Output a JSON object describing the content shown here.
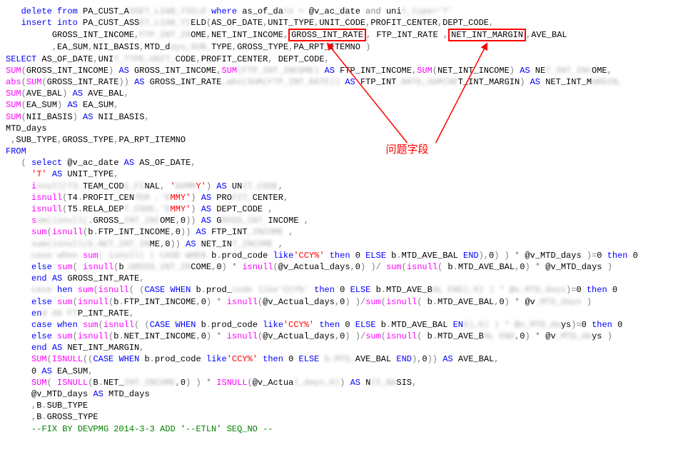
{
  "label": "问题字段",
  "box1_text": "GROSS_INT_RATE",
  "box2_text": "NET_INT_MARGIN",
  "code": {
    "l01": {
      "a": "delete from",
      "b": " PA_CUST_A",
      "blur1": "SSET_LIAB",
      "blur2": "_YIELD ",
      "c": "where",
      "d": " as_of_da",
      "blur3": "te =",
      "e": " @v_ac_date ",
      "f": "and",
      "g": " uni",
      "blur4": "t_type='T'"
    },
    "l02": {
      "a": "insert into",
      "b": " PA_CUST_ASS",
      "blur1": "ET_LIAB_YI",
      "c": "ELD",
      "d": "AS_OF_DATE",
      "e": "UNIT_TYPE",
      "f": "UNIT_CODE",
      "g": "PROFIT_CENTER",
      "h": "DEPT_CODE"
    },
    "l03": {
      "a": "GROSS_INT_INCOME",
      "blur1": "FTP_INT_IN",
      "b": "OME",
      "c": "NET_INT_INCOME",
      "d": " FTP_INT_RATE ",
      "e": "AVE_BAL"
    },
    "l04": {
      "a": "EA_SUM",
      "b": "NII_BASIS",
      "c": "MTD_d",
      "blur1": "ays,S",
      "blur2": "UB_",
      "d": "TYPE",
      "e": "GROSS_TYPE",
      "f": "PA_RPT_ITEMNO"
    },
    "l05": {
      "a": "SELECT",
      "b": " AS_OF_DATE",
      "c": "UNI",
      "blur1": "T_TYPE,UNIT_",
      "d": "CODE",
      "e": "PROFIT_CENTER",
      "f": " DEPT_CODE"
    },
    "l06": {
      "a": "SUM",
      "b": "GROSS_INT_INCOME",
      "c": "AS",
      "d": " GROSS_INT_INCOME",
      "e": "SUM",
      "blur1": "(FTP_INT_INCOME)",
      "f": "AS",
      "g": " FTP_INT_INCOME",
      "h": "SUM",
      "i": "NET_INT_INCOME",
      "j": "AS",
      "k": " NE",
      "blur2": "T_INT_INC",
      "l": "OME"
    },
    "l07": {
      "a": "abs",
      "b": "SUM",
      "c": "GROSS_INT_RATE",
      "d": "AS",
      "e": " GROSS_INT_RATE",
      "blur1": ",abs(SUM(FTP_INT_RATE))",
      "f": "AS",
      "g": " FTP_INT",
      "blur2": "_RATE,SUM(NE",
      "h": "T_INT_MARGIN",
      "i": "AS",
      "j": " NET_INT_M",
      "blur3": "ARGIN,"
    },
    "l08": {
      "a": "SUM",
      "b": "AVE_BAL",
      "c": "AS",
      "d": " AVE_BAL"
    },
    "l09": {
      "a": "SUM",
      "b": "EA_SUM",
      "c": "AS",
      "d": " EA_SUM"
    },
    "l10": {
      "a": "SUM",
      "b": "NII_BASIS",
      "c": "AS",
      "d": " NII_BASIS"
    },
    "l11": {
      "a": "MTD_days"
    },
    "l12": {
      "a": "SUB_TYPE",
      "b": "GROSS_TYPE",
      "c": "PA_RPT_ITEMNO"
    },
    "l13": {
      "a": "FROM"
    },
    "l14": {
      "a": "select",
      "b": " @v_ac_date ",
      "c": "AS",
      "d": " AS_OF_DATE"
    },
    "l15": {
      "a": "'T'",
      "b": "AS",
      "c": " UNIT_TYPE"
    },
    "l16": {
      "a": "i",
      "blur1": "snull(T3.",
      "b": "TEAM_COD",
      "blur2": "E_FI",
      "c": "NAL",
      "d": "'",
      "blur3": "DUMM",
      "e": "Y'",
      "f": "AS",
      "g": " UN",
      "blur4": "IT_CODE"
    },
    "l17": {
      "a": "isnull",
      "b": "T4",
      "c": "PROFIT_CEN",
      "blur1": "TER ,'D",
      "d": "MMY'",
      "e": "AS",
      "f": " PRO",
      "blur2": "FIT_",
      "g": "CENTER"
    },
    "l18": {
      "a": "isnull",
      "b": "T5",
      "c": "RELA_DEP",
      "blur1": "T_CODE,'D",
      "d": "MMY'",
      "e": "AS",
      "f": " DEPT_CODE"
    },
    "l19": {
      "a": "s",
      "blur1": "um(isnull(",
      "b": "GROSS_",
      "blur2": "INT_INC",
      "c": "OME",
      "d": "0",
      "e": "AS",
      "f": " G",
      "blur3": "ROSS_INT_",
      "g": "INCOME"
    },
    "l20": {
      "a": "sum",
      "b": "isnull",
      "c": "b",
      "d": "FTP_INT_INCOME",
      "e": "0",
      "f": "AS",
      "g": " FTP_INT",
      "blur1": "_INCOME"
    },
    "l21": {
      "a": "sum(isnull(b.NET_INT_IN",
      "b": "ME",
      "c": "0",
      "d": "AS",
      "e": " NET_IN",
      "blur1": "T_INCOME"
    },
    "l22": {
      "blur1": "case when",
      "a": "sum",
      "blur2": "( isnull( ( CASE WHEN",
      "b": " b",
      "c": "prod_code ",
      "d": "like",
      "e": "'CCY%'",
      "f": "then",
      "g": " 0 ",
      "h": "ELSE",
      "i": "  b",
      "j": "MTD_AVE_BAL ",
      "k": "END",
      "l": "0",
      "m": " @v_MTD_days",
      "n": "0 ",
      "o": "then",
      "p": " 0"
    },
    "l23": {
      "a": "else",
      "b": "sum",
      "c": "isnull",
      "d": "b",
      "blur1": ".GROSS_INT_IN",
      "e": "COME",
      "f": "0",
      "g": "isnull",
      "h": "@v_Actual_days",
      "i": "0",
      "j": "sum",
      "k": "isnull",
      "l": " b",
      "m": "MTD_AVE_BAL",
      "n": "0",
      "o": " @v_MTD_days"
    },
    "l24": {
      "a": "end",
      "b": "AS",
      "c": " GROSS_INT_RATE"
    },
    "l25": {
      "blur1": "case",
      "a": "hen ",
      "b": "sum",
      "c": "isnull",
      "d": "CASE WHEN",
      "e": " b",
      "f": "prod_",
      "blur2": "code like'CCY%'",
      "g": "then",
      "h": " 0 ",
      "i": "ELSE",
      "j": "  b",
      "k": "MTD_AVE_B",
      "blur3": "AL END),0) ) * @v_MTD_days",
      "l": "0 ",
      "m": "then",
      "n": " 0"
    },
    "l26": {
      "a": "else",
      "b": "sum",
      "c": "isnull",
      "d": "b",
      "e": "FTP_INT_INCOME",
      "f": "0",
      "g": "isnull",
      "h": "@v_Actual_days",
      "i": "0",
      "j": "sum",
      "k": "isnull",
      "l": " b",
      "m": "MTD_AVE_BAL",
      "n": "0",
      "o": " @v",
      "blur1": "_MTD_days"
    },
    "l27": {
      "a": "en",
      "blur1": "d AS FT",
      "b": "P_INT_RATE"
    },
    "l28": {
      "a": "case when ",
      "b": "sum",
      "c": "isnull",
      "d": "CASE WHEN",
      "e": " b",
      "f": "prod_code ",
      "g": "like",
      "h": "'CCY%'",
      "i": "then",
      "j": " 0 ",
      "k": "ELSE",
      "l": "  b",
      "m": "MTD_AVE_BAL ",
      "n": "EN",
      "blur1": "D),0) ) * @v_MTD_da",
      "o": "ys",
      "p": "0 ",
      "q": "then",
      "r": " 0"
    },
    "l29": {
      "a": "else",
      "b": "sum",
      "c": "isnull",
      "d": "b",
      "e": "NET_INT_INCOME",
      "f": "0",
      "g": "isnull",
      "h": "@v_Actual_days",
      "i": "0",
      "j": "sum",
      "k": "isnull",
      "l": " b",
      "m": "MTD_AVE_B",
      "blur1": "AL END",
      "n": "0",
      "o": " @v",
      "blur2": "_MTD_da",
      "p": "ys"
    },
    "l30": {
      "a": "end",
      "b": "AS",
      "c": " NET_INT_MARGIN"
    },
    "l31": {
      "a": "SUM",
      "b": "ISNULL",
      "c": "CASE WHEN",
      "d": " b",
      "e": "prod_code ",
      "f": "like",
      "g": "'CCY%'",
      "h": "then",
      "i": " 0 ",
      "j": "ELSE",
      "k": "  ",
      "blur1": "b.MTD_",
      "l": "AVE_BAL ",
      "m": "END",
      "n": "0",
      "o": "AS",
      "p": " AVE_BAL"
    },
    "l32": {
      "a": "0 ",
      "b": "AS",
      "c": " EA_SUM"
    },
    "l33": {
      "a": "SUM",
      "b": "ISNULL",
      "c": "B",
      "d": "NET_",
      "blur1": "INT_INCOME",
      "e": "0",
      "f": "ISNULL",
      "g": "@v_Actua",
      "blur2": "l_days,0)",
      "h": "AS",
      "i": " N",
      "blur3": "II_BA",
      "j": "SIS"
    },
    "l34": {
      "a": "@v_MTD_days ",
      "b": "AS",
      "c": " MTD_days"
    },
    "l35": {
      "a": "B",
      "b": "SUB_TYPE"
    },
    "l36": {
      "a": "B",
      "b": "GROSS_TYPE"
    },
    "l37": {
      "a": "--FIX BY DEVPMG 2014-3-3 ADD '--ETLN' SEQ_NO  --"
    }
  }
}
